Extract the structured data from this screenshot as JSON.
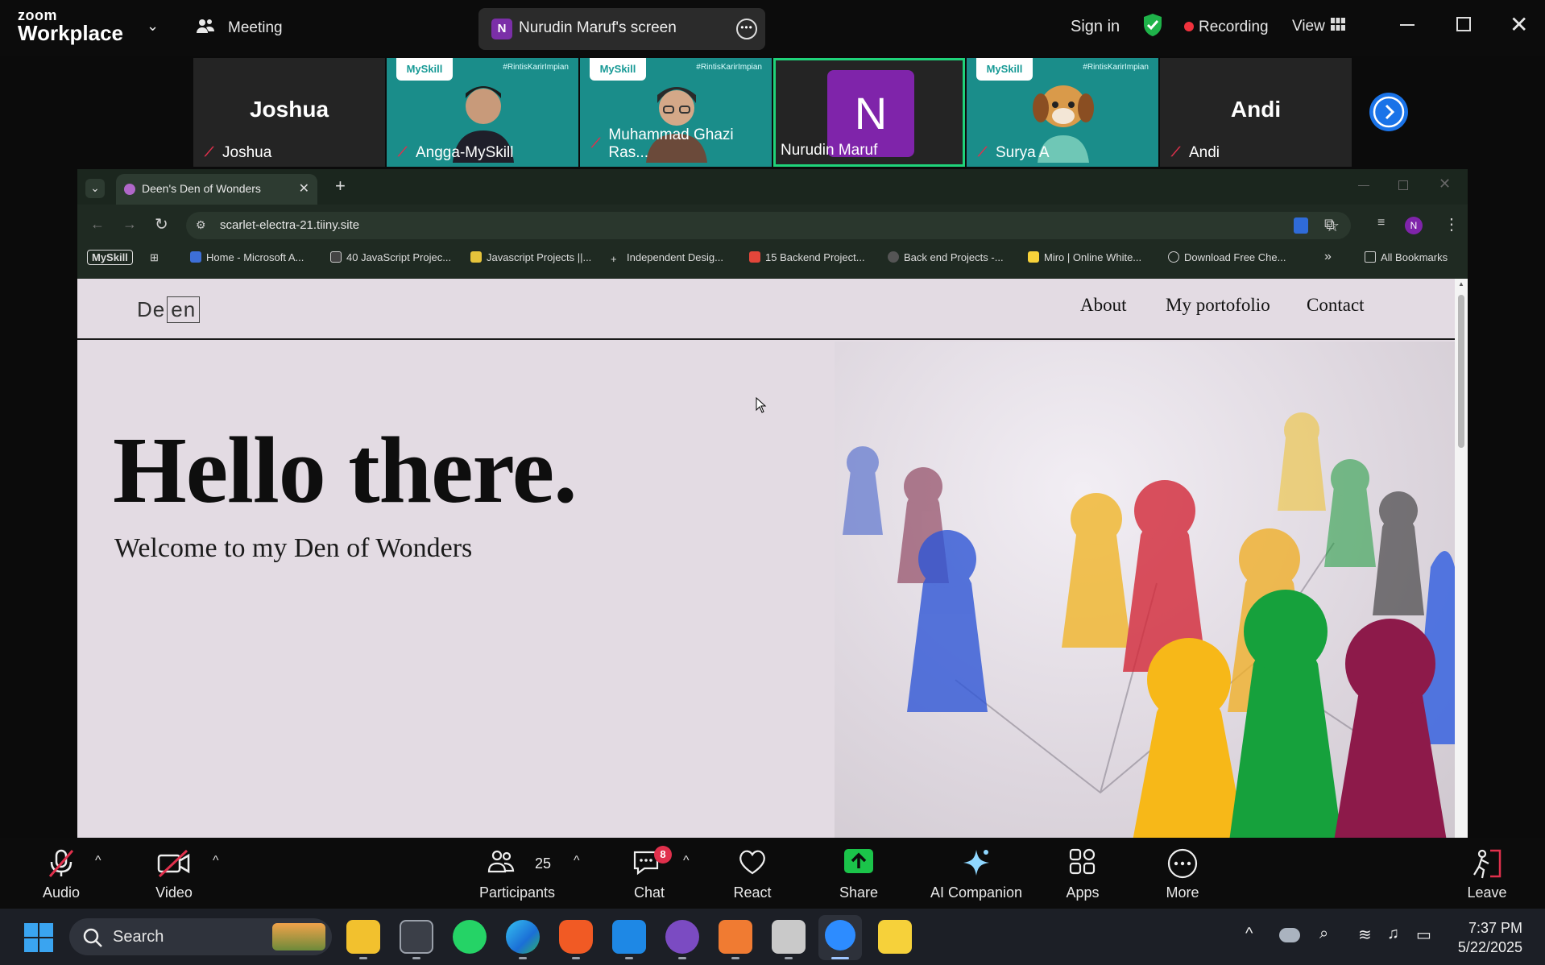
{
  "zoom": {
    "logo_top": "zoom",
    "logo_bottom": "Workplace",
    "meeting_label": "Meeting",
    "share_initial": "N",
    "share_label": "Nurudin Maruf's screen",
    "sign_in": "Sign in",
    "recording": "Recording",
    "view": "View",
    "participants": [
      {
        "name": "Joshua",
        "big": "Joshua",
        "type": "name"
      },
      {
        "name": "Angga-MySkill",
        "type": "video",
        "badge": "MySkill",
        "tag": "#RintisKarirImpian"
      },
      {
        "name": "Muhammad Ghazi Ras...",
        "type": "video",
        "badge": "MySkill",
        "tag": "#RintisKarirImpian"
      },
      {
        "name": "Nurudin Maruf",
        "type": "avatar",
        "initial": "N"
      },
      {
        "name": "Surya A",
        "type": "video",
        "badge": "MySkill",
        "tag": "#RintisKarirImpian"
      },
      {
        "name": "Andi",
        "big": "Andi",
        "type": "name"
      }
    ],
    "toolbar": {
      "audio": "Audio",
      "video": "Video",
      "participants": "Participants",
      "participants_count": "25",
      "chat": "Chat",
      "chat_badge": "8",
      "react": "React",
      "share": "Share",
      "ai_companion": "AI Companion",
      "apps": "Apps",
      "more": "More",
      "leave": "Leave"
    }
  },
  "browser": {
    "tab_title": "Deen's Den of Wonders",
    "url": "scarlet-electra-21.tiiny.site",
    "profile_initial": "N",
    "bookmarks": [
      "MySkill",
      "Home - Microsoft A...",
      "40 JavaScript Projec...",
      "Javascript Projects ||...",
      "Independent Desig...",
      "15 Backend Project...",
      "Back end Projects -...",
      "Miro | Online White...",
      "Download Free Che..."
    ],
    "all_bookmarks": "All Bookmarks"
  },
  "site": {
    "logo_a": "De",
    "logo_b": "en",
    "nav": [
      "About",
      "My portofolio",
      "Contact"
    ],
    "hero_title": "Hello there.",
    "hero_subtitle": "Welcome to my Den of Wonders"
  },
  "taskbar": {
    "search": "Search",
    "time": "7:37 PM",
    "date": "5/22/2025"
  }
}
